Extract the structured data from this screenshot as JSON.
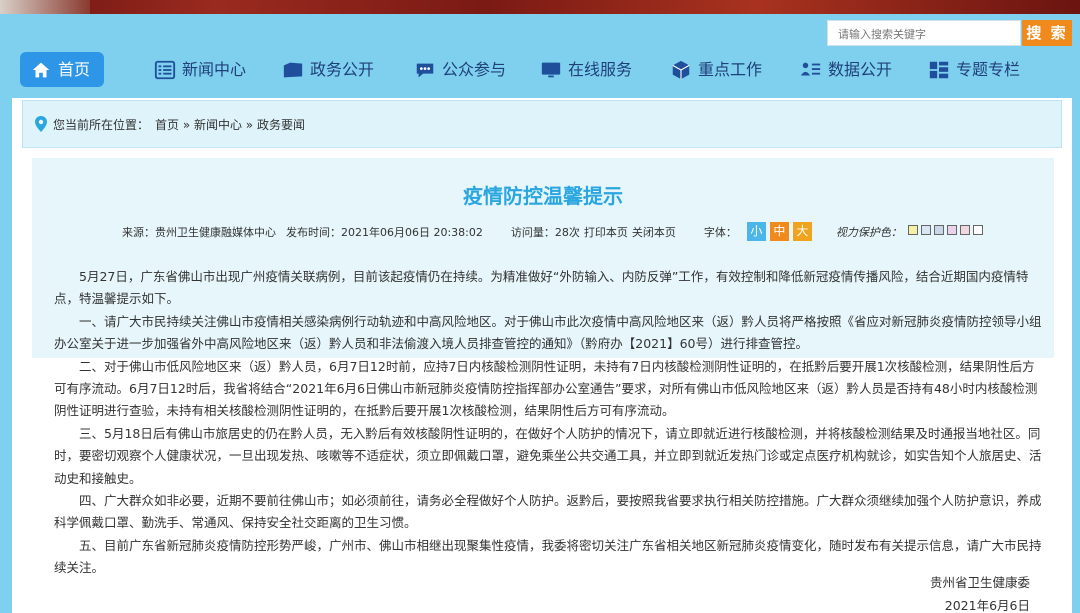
{
  "search": {
    "placeholder": "请输入搜索关键字",
    "button": "搜 索"
  },
  "nav": [
    {
      "label": "首页",
      "icon": "home-icon"
    },
    {
      "label": "新闻中心",
      "icon": "news-icon"
    },
    {
      "label": "政务公开",
      "icon": "folder-icon"
    },
    {
      "label": "公众参与",
      "icon": "chat-icon"
    },
    {
      "label": "在线服务",
      "icon": "monitor-icon"
    },
    {
      "label": "重点工作",
      "icon": "box-icon"
    },
    {
      "label": "数据公开",
      "icon": "data-icon"
    },
    {
      "label": "专题专栏",
      "icon": "grid-icon"
    }
  ],
  "breadcrumb": {
    "prefix": "您当前所在位置：",
    "path": "首页 » 新闻中心 » 政务要闻"
  },
  "article": {
    "title": "疫情防控温馨提示",
    "source": "来源：贵州卫生健康融媒体中心",
    "publish_time": "发布时间：2021年06月06日 20:38:02",
    "visits": "访问量：28次",
    "print": "打印本页",
    "close": "关闭本页",
    "font_label": "字体：",
    "font_small": "小",
    "font_medium": "中",
    "font_large": "大",
    "vision_label": "视力保护色：",
    "vision_colors": [
      "#f5f0a8",
      "#d8e6f2",
      "#c9d6e8",
      "#e8d3ea",
      "#f2d6e0",
      "#ffffff"
    ],
    "paragraphs": [
      "5月27日，广东省佛山市出现广州疫情关联病例，目前该起疫情仍在持续。为精准做好“外防输入、内防反弹”工作，有效控制和降低新冠疫情传播风险，结合近期国内疫情特点，特温馨提示如下。",
      "一、请广大市民持续关注佛山市疫情相关感染病例行动轨迹和中高风险地区。对于佛山市此次疫情中高风险地区来（返）黔人员将严格按照《省应对新冠肺炎疫情防控领导小组办公室关于进一步加强省外中高风险地区来（返）黔人员和非法偷渡入境人员排查管控的通知》（黔府办【2021】60号）进行排查管控。",
      "二、对于佛山市低风险地区来（返）黔人员，6月7日12时前，应持7日内核酸检测阴性证明，未持有7日内核酸检测阴性证明的，在抵黔后要开展1次核酸检测，结果阴性后方可有序流动。6月7日12时后，我省将结合“2021年6月6日佛山市新冠肺炎疫情防控指挥部办公室通告”要求，对所有佛山市低风险地区来（返）黔人员是否持有48小时内核酸检测阴性证明进行查验，未持有相关核酸检测阴性证明的，在抵黔后要开展1次核酸检测，结果阴性后方可有序流动。",
      "三、5月18日后有佛山市旅居史的仍在黔人员，无入黔后有效核酸阴性证明的，在做好个人防护的情况下，请立即就近进行核酸检测，并将核酸检测结果及时通报当地社区。同时，要密切观察个人健康状况，一旦出现发热、咳嗽等不适症状，须立即佩戴口罩，避免乘坐公共交通工具，并立即到就近发热门诊或定点医疗机构就诊，如实告知个人旅居史、活动史和接触史。",
      "四、广大群众如非必要，近期不要前往佛山市；如必须前往，请务必全程做好个人防护。返黔后，要按照我省要求执行相关防控措施。广大群众须继续加强个人防护意识，养成科学佩戴口罩、勤洗手、常通风、保持安全社交距离的卫生习惯。",
      "五、目前广东省新冠肺炎疫情防控形势严峻，广州市、佛山市相继出现聚集性疫情，我委将密切关注广东省相关地区新冠肺炎疫情变化，随时发布有关提示信息，请广大市民持续关注。"
    ],
    "signature": "贵州省卫生健康委",
    "date": "2021年6月6日"
  },
  "colors": {
    "accent": "#2aa6e0",
    "nav_active": "#2e96e6",
    "search_button": "#f08a1c",
    "font_small": "#4cb6ea",
    "font_medium": "#f08a1c",
    "font_large": "#f0a31c"
  }
}
